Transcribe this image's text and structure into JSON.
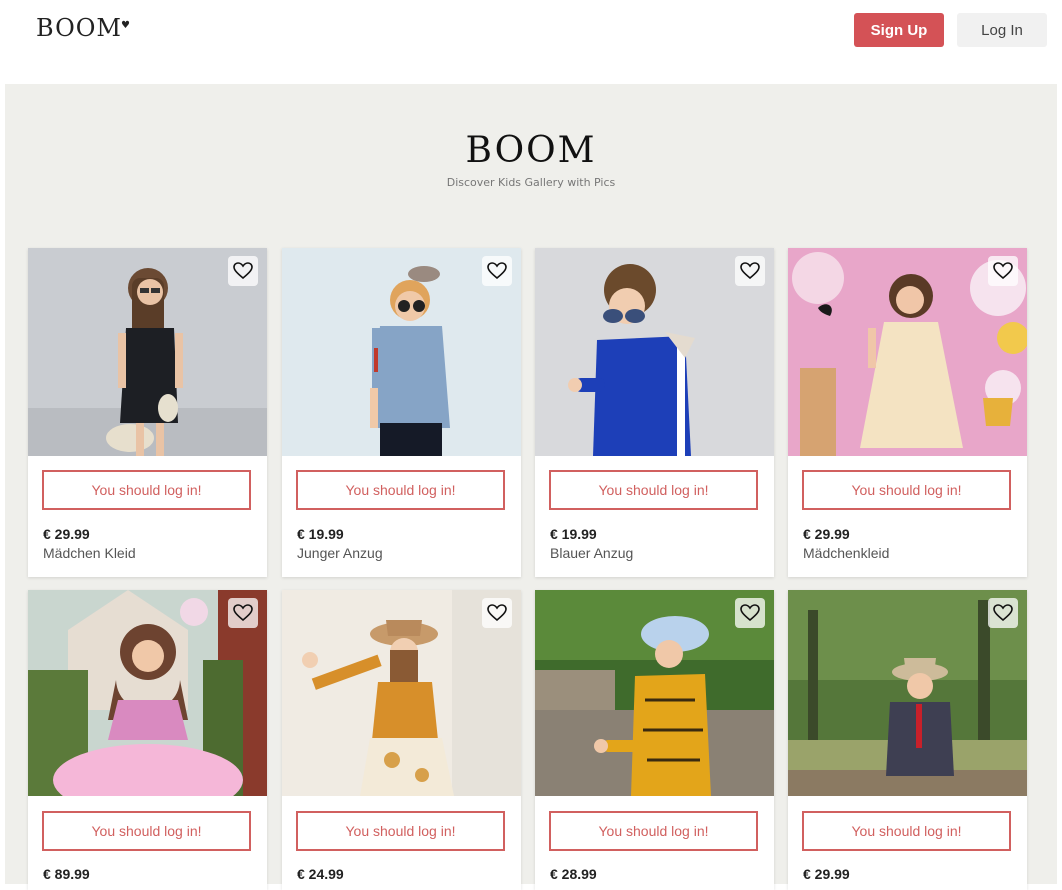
{
  "header": {
    "logo": "BOOM",
    "signup_label": "Sign Up",
    "login_label": "Log In"
  },
  "hero": {
    "title": "BOOM",
    "subtitle": "Discover Kids Gallery with Pics"
  },
  "products": [
    {
      "price": "€ 29.99",
      "name": "Mädchen Kleid",
      "cta": "You should log in!"
    },
    {
      "price": "€ 19.99",
      "name": "Junger Anzug",
      "cta": "You should log in!"
    },
    {
      "price": "€ 19.99",
      "name": "Blauer Anzug",
      "cta": "You should log in!"
    },
    {
      "price": "€ 29.99",
      "name": "Mädchenkleid",
      "cta": "You should log in!"
    },
    {
      "price": "€ 89.99",
      "name": "",
      "cta": "You should log in!"
    },
    {
      "price": "€ 24.99",
      "name": "",
      "cta": "You should log in!"
    },
    {
      "price": "€ 28.99",
      "name": "",
      "cta": "You should log in!"
    },
    {
      "price": "€ 29.99",
      "name": "",
      "cta": "You should log in!"
    }
  ],
  "colors": {
    "accent": "#d45256",
    "background": "#efefeb"
  },
  "icons": {
    "favorite": "heart-icon"
  }
}
